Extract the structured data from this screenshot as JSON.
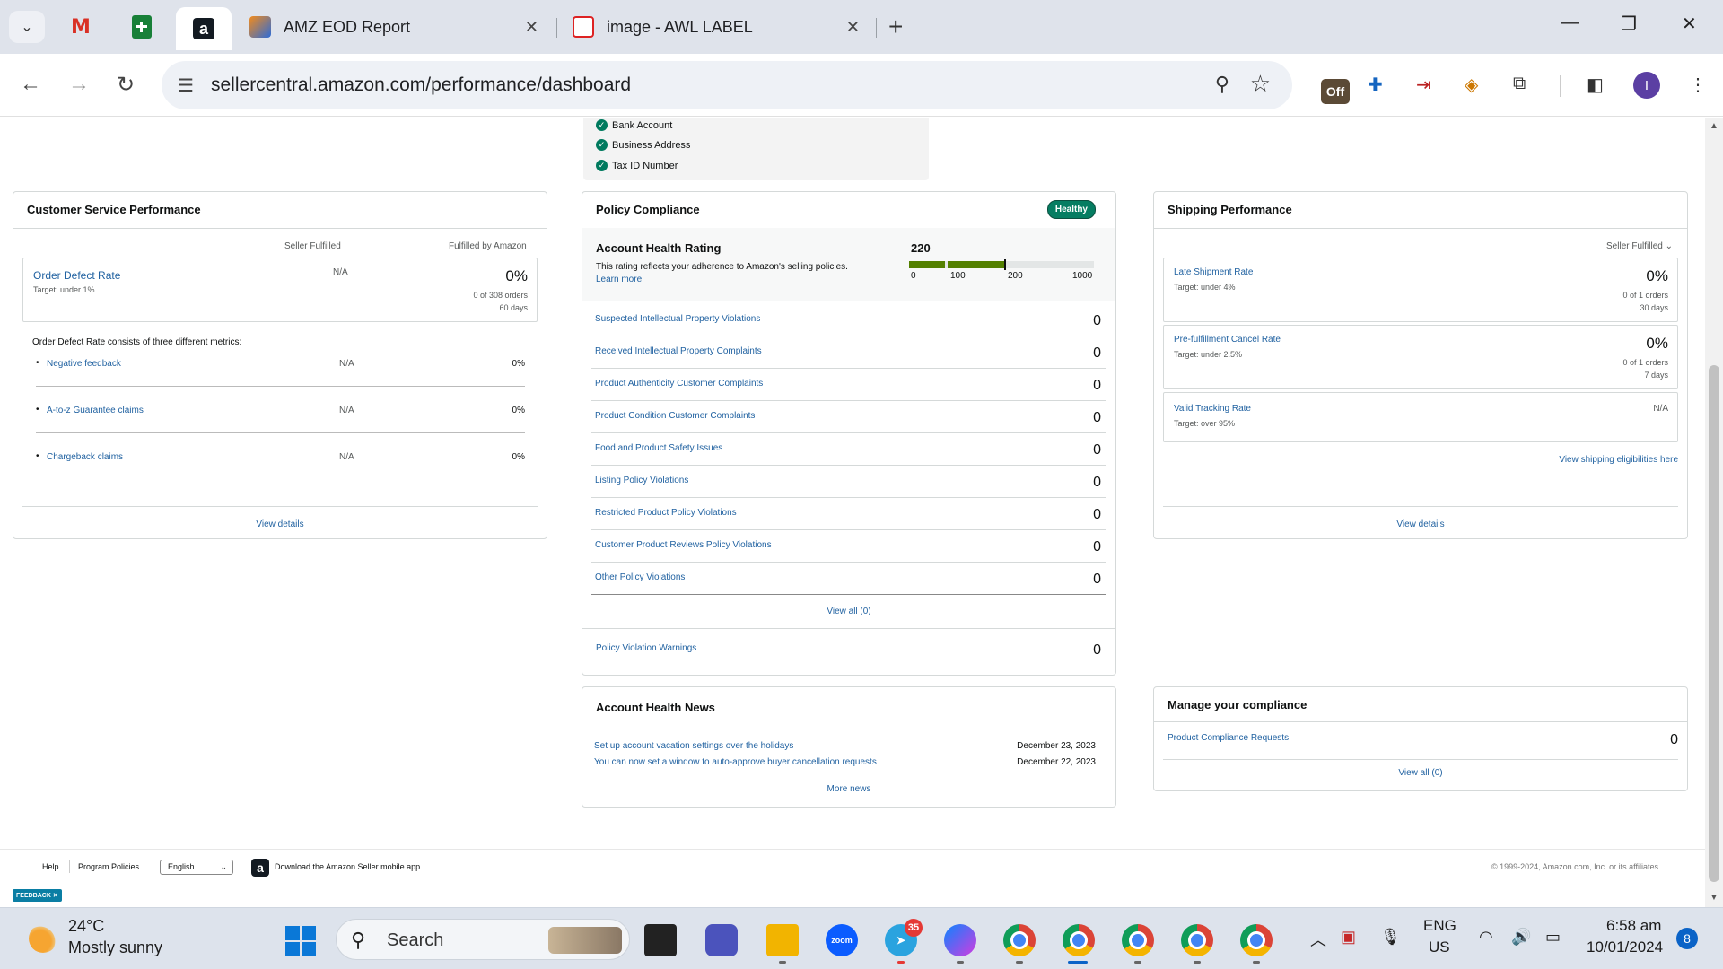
{
  "browser": {
    "tabs": [
      {
        "title": "AMZ EOD Report"
      },
      {
        "title": "image - AWL LABEL"
      }
    ],
    "url": "sellercentral.amazon.com/performance/dashboard",
    "profile_initial": "I",
    "off_badge": "Off"
  },
  "verification": {
    "items": [
      "Bank Account",
      "Business Address",
      "Tax ID Number"
    ]
  },
  "customer_service": {
    "title": "Customer Service Performance",
    "col_seller": "Seller Fulfilled",
    "col_amazon": "Fulfilled by Amazon",
    "odr": {
      "label": "Order Defect Rate",
      "target": "Target: under 1%",
      "seller": "N/A",
      "amazon": "0%",
      "orders": "0 of 308 orders",
      "period": "60 days"
    },
    "consists_text": "Order Defect Rate consists of three different metrics:",
    "metrics": [
      {
        "label": "Negative feedback",
        "seller": "N/A",
        "amazon": "0%"
      },
      {
        "label": "A-to-z Guarantee claims",
        "seller": "N/A",
        "amazon": "0%"
      },
      {
        "label": "Chargeback claims",
        "seller": "N/A",
        "amazon": "0%"
      }
    ],
    "view_details": "View details"
  },
  "policy": {
    "title": "Policy Compliance",
    "status": "Healthy",
    "ahr_title": "Account Health Rating",
    "ahr_desc": "This rating reflects your adherence to Amazon's selling policies.",
    "learn_more": "Learn more.",
    "ahr_value": "220",
    "bar_labels": [
      "0",
      "100",
      "200",
      "1000"
    ],
    "rows": [
      {
        "label": "Suspected Intellectual Property Violations",
        "count": "0"
      },
      {
        "label": "Received Intellectual Property Complaints",
        "count": "0"
      },
      {
        "label": "Product Authenticity Customer Complaints",
        "count": "0"
      },
      {
        "label": "Product Condition Customer Complaints",
        "count": "0"
      },
      {
        "label": "Food and Product Safety Issues",
        "count": "0"
      },
      {
        "label": "Listing Policy Violations",
        "count": "0"
      },
      {
        "label": "Restricted Product Policy Violations",
        "count": "0"
      },
      {
        "label": "Customer Product Reviews Policy Violations",
        "count": "0"
      },
      {
        "label": "Other Policy Violations",
        "count": "0"
      }
    ],
    "view_all": "View all (0)",
    "warnings_label": "Policy Violation Warnings",
    "warnings_count": "0"
  },
  "shipping": {
    "title": "Shipping Performance",
    "filter": "Seller Fulfilled",
    "metrics": [
      {
        "label": "Late Shipment Rate",
        "target": "Target: under 4%",
        "value": "0%",
        "orders": "0 of 1 orders",
        "period": "30 days"
      },
      {
        "label": "Pre-fulfillment Cancel Rate",
        "target": "Target: under 2.5%",
        "value": "0%",
        "orders": "0 of 1 orders",
        "period": "7 days"
      },
      {
        "label": "Valid Tracking Rate",
        "target": "Target: over 95%",
        "value": "N/A"
      }
    ],
    "eligibilities": "View shipping eligibilities here",
    "view_details": "View details"
  },
  "news": {
    "title": "Account Health News",
    "items": [
      {
        "text": "Set up account vacation settings over the holidays",
        "date": "December 23, 2023"
      },
      {
        "text": "You can now set a window to auto-approve buyer cancellation requests",
        "date": "December 22, 2023"
      }
    ],
    "more": "More news"
  },
  "manage": {
    "title": "Manage your compliance",
    "row_label": "Product Compliance Requests",
    "row_count": "0",
    "view_all": "View all (0)"
  },
  "footer": {
    "help": "Help",
    "policies": "Program Policies",
    "language": "English",
    "app": "Download the Amazon Seller mobile app",
    "copyright": "© 1999-2024, Amazon.com, Inc. or its affiliates",
    "feedback": "FEEDBACK"
  },
  "taskbar": {
    "temp": "24°C",
    "weather": "Mostly sunny",
    "search": "Search",
    "telegram_badge": "35",
    "lang1": "ENG",
    "lang2": "US",
    "time": "6:58 am",
    "date": "10/01/2024",
    "notif_count": "8"
  }
}
